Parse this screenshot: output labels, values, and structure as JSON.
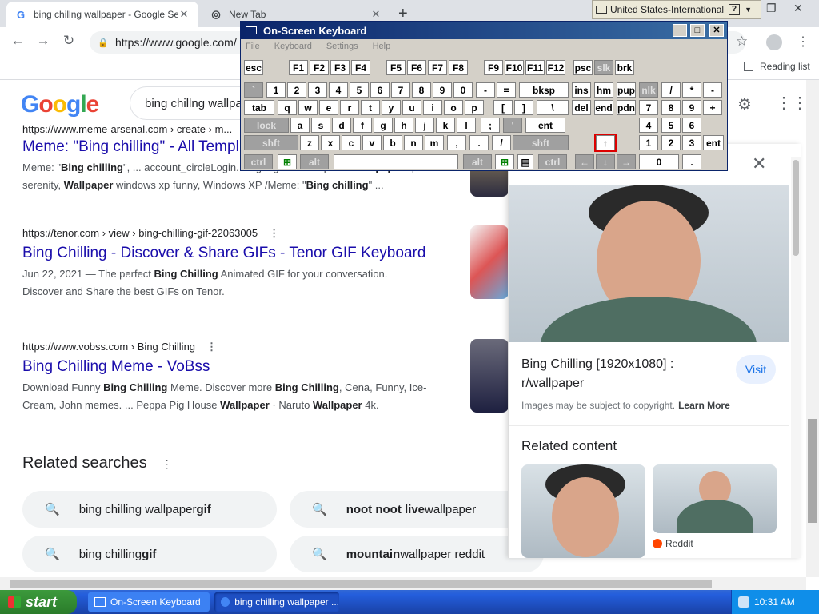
{
  "browser": {
    "tabs": [
      {
        "title": "bing chillng wallpaper - Google Search",
        "favicon": "G"
      },
      {
        "title": "New Tab"
      }
    ],
    "new_tab": "+",
    "url": "https://www.google.com/",
    "reading_list": "Reading list",
    "ime": "United States-International",
    "ime_help": "?"
  },
  "google": {
    "logo": [
      "G",
      "o",
      "o",
      "g",
      "l",
      "e"
    ],
    "logo_colors": [
      "#4285f4",
      "#ea4335",
      "#fbbc05",
      "#4285f4",
      "#34a853",
      "#ea4335"
    ],
    "query": "bing chillng wallpaper"
  },
  "results": [
    {
      "url": "https://www.meme-arsenal.com › create › m...",
      "title": "Meme: \"Bing chilling\" - All Templ...",
      "snip1_a": "Meme: \"",
      "snip1_b": "Bing chilling",
      "snip1_c": "\", ... account_circleLogin. language. All Templates/",
      "snip1_d": "Wallpaper",
      "snip1_e": " xp",
      "snip2_a": "serenity, ",
      "snip2_b": "Wallpaper",
      "snip2_c": " windows xp funny, Windows XP /Meme: \"",
      "snip2_d": "Bing chilling",
      "snip2_e": "\" ..."
    },
    {
      "url": "https://tenor.com › view › bing-chilling-gif-22063005",
      "more": "⋮",
      "title": "Bing Chilling - Discover & Share GIFs - Tenor GIF Keyboard",
      "snip_a": "Jun 22, 2021 — The perfect ",
      "snip_b": "Bing Chilling",
      "snip_c": " Animated GIF for your conversation.",
      "snip2": "Discover and Share the best GIFs on Tenor."
    },
    {
      "url": "https://www.vobss.com › Bing Chilling",
      "more": "⋮",
      "title": "Bing Chilling Meme - VoBss",
      "snip1_a": "Download Funny ",
      "snip1_b": "Bing Chilling",
      "snip1_c": " Meme. Discover more ",
      "snip1_d": "Bing Chilling",
      "snip1_e": ", Cena, Funny, Ice-",
      "snip2_a": "Cream, John memes. ... Peppa Pig House ",
      "snip2_b": "Wallpaper",
      "snip2_c": " · Naruto ",
      "snip2_d": "Wallpaper",
      "snip2_e": " 4k."
    }
  ],
  "related": {
    "title": "Related searches",
    "dots": "⋮",
    "chips": [
      {
        "normal": "bing chilling wallpaper ",
        "bold": "gif",
        "bold_first": false
      },
      {
        "normal": " wallpaper",
        "bold": "noot noot live",
        "bold_first": true
      },
      {
        "normal": "bing chilling ",
        "bold": "gif",
        "bold_first": false
      },
      {
        "normal": " wallpaper reddit",
        "bold": "mountain",
        "bold_first": true
      }
    ]
  },
  "panel": {
    "close": "✕",
    "caption": "Bing Chilling [1920x1080] : r/wallpaper",
    "visit": "Visit",
    "copyright": "Images may be subject to copyright.",
    "learn_more": "Learn More",
    "related_content": "Related content",
    "source": "Reddit"
  },
  "osk": {
    "title": "On-Screen Keyboard",
    "menu": [
      "File",
      "Keyboard",
      "Settings",
      "Help"
    ],
    "rows": [
      [
        "esc",
        "F1",
        "F2",
        "F3",
        "F4",
        "F5",
        "F6",
        "F7",
        "F8",
        "F9",
        "F10",
        "F11",
        "F12",
        "psc",
        "slk",
        "brk"
      ],
      [
        "`",
        "1",
        "2",
        "3",
        "4",
        "5",
        "6",
        "7",
        "8",
        "9",
        "0",
        "-",
        "=",
        "bksp",
        "ins",
        "hm",
        "pup",
        "nlk",
        "/",
        "*",
        "-"
      ],
      [
        "tab",
        "q",
        "w",
        "e",
        "r",
        "t",
        "y",
        "u",
        "i",
        "o",
        "p",
        "[",
        "]",
        "\\",
        "del",
        "end",
        "pdn",
        "7",
        "8",
        "9",
        "+"
      ],
      [
        "lock",
        "a",
        "s",
        "d",
        "f",
        "g",
        "h",
        "j",
        "k",
        "l",
        ";",
        "'",
        "ent",
        "4",
        "5",
        "6"
      ],
      [
        "shft",
        "z",
        "x",
        "c",
        "v",
        "b",
        "n",
        "m",
        ",",
        ".",
        "/",
        "shft",
        "↑",
        "1",
        "2",
        "3",
        "ent"
      ],
      [
        "ctrl",
        "⊞",
        "alt",
        "alt",
        "⊞",
        "▤",
        "ctrl",
        "←",
        "↓",
        "→",
        "0",
        "."
      ]
    ]
  },
  "taskbar": {
    "start": "start",
    "tasks": [
      "On-Screen Keyboard",
      "bing chilling wallpaper ..."
    ],
    "time": "10:31 AM"
  }
}
